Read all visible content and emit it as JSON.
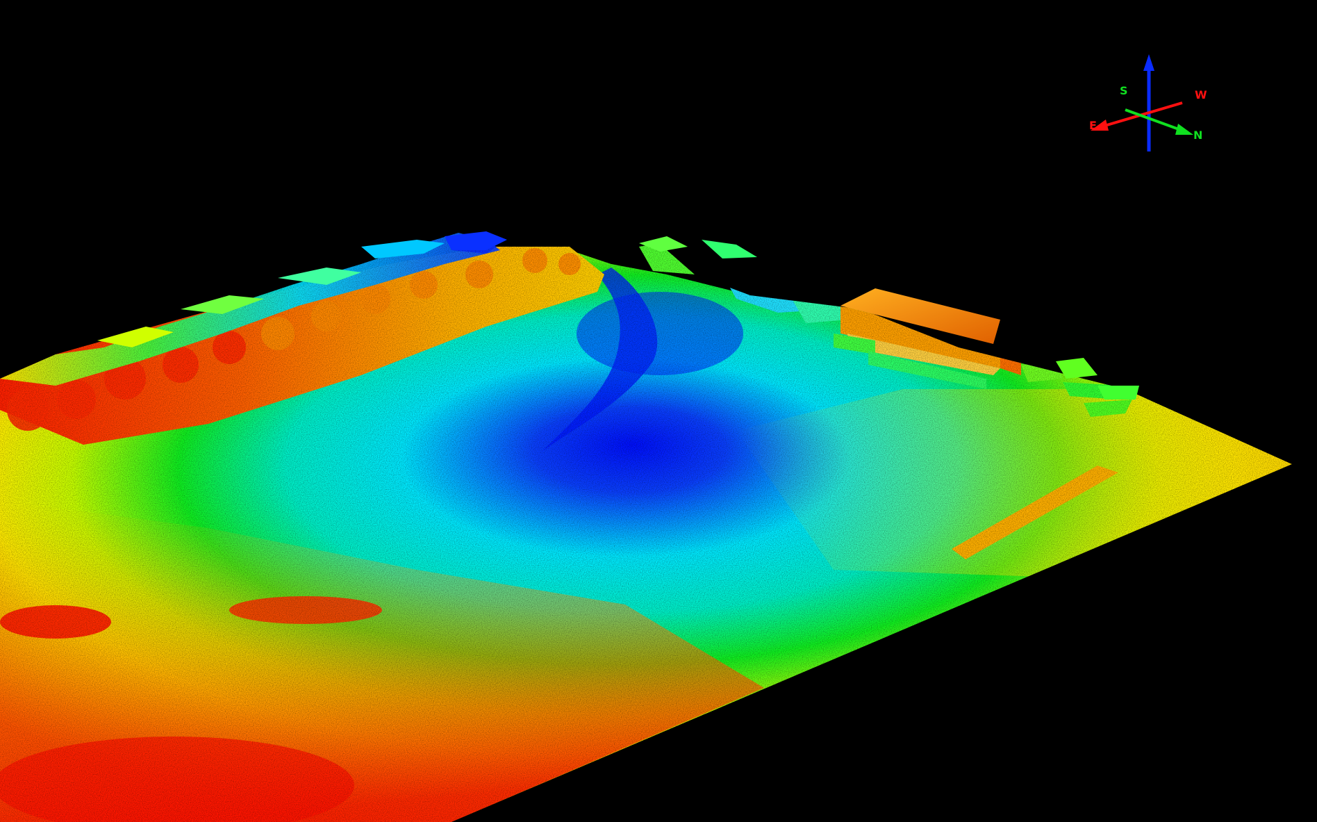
{
  "view": {
    "background": "#000000",
    "colormap": [
      "#ff0000",
      "#ff8000",
      "#ffff00",
      "#00ff00",
      "#00ffff",
      "#0000ff"
    ]
  },
  "axis_gizmo": {
    "labels": {
      "north": "N",
      "south": "S",
      "east": "E",
      "west": "W"
    },
    "colors": {
      "up": "#0a2cff",
      "east_west": "#ff1010",
      "north_south": "#10e020"
    },
    "icons": [
      "up-axis-icon",
      "east-west-axis-icon",
      "north-south-axis-icon"
    ]
  }
}
